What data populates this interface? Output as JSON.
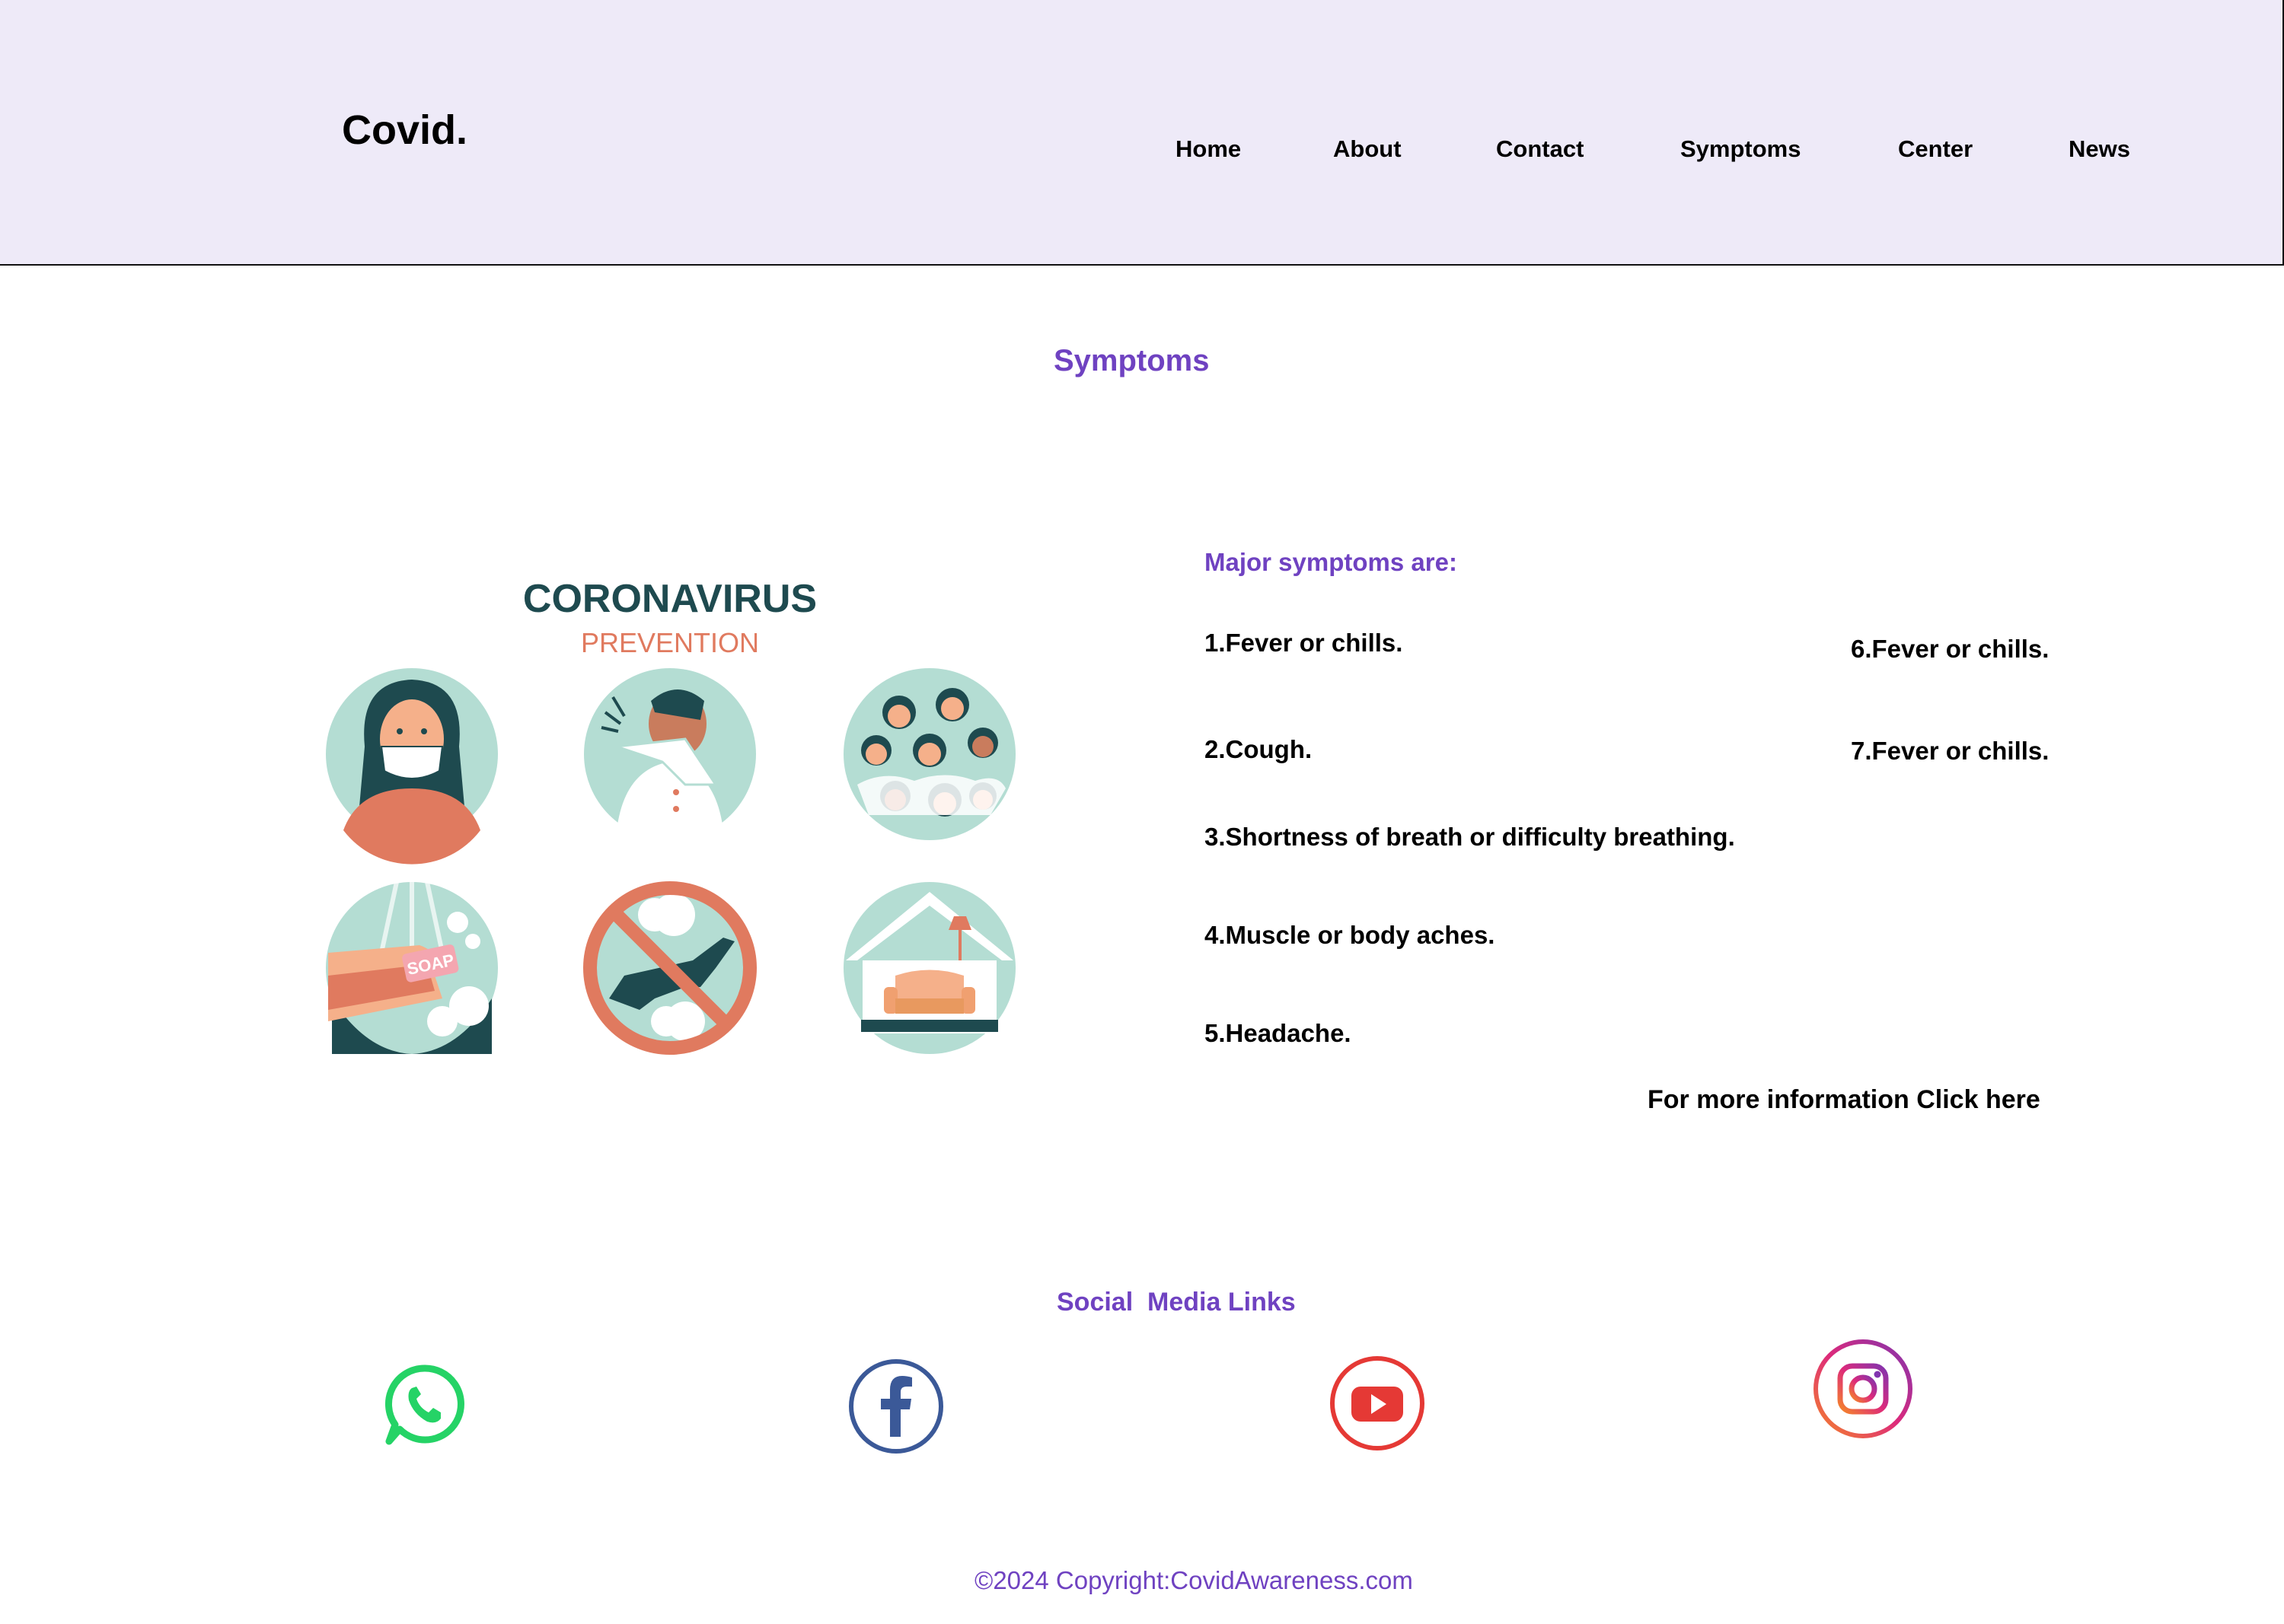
{
  "header": {
    "logo": "Covid.",
    "nav": [
      "Home",
      "About",
      "Contact",
      "Symptoms",
      "Center",
      "News"
    ]
  },
  "main": {
    "title": "Symptoms",
    "illustration": {
      "heading": "CORONAVIRUS",
      "subheading": "PREVENTION",
      "soap_label": "SOAP",
      "icons": [
        "face-mask-icon",
        "cough-into-elbow-icon",
        "avoid-crowds-icon",
        "wash-hands-icon",
        "no-travel-icon",
        "stay-home-icon"
      ]
    },
    "symptoms_heading": "Major symptoms are:",
    "symptoms": [
      "1.Fever or chills.",
      "2.Cough.",
      "3.Shortness of breath or difficulty breathing.",
      "4.Muscle or body aches.",
      "5.Headache.",
      "6.Fever or chills.",
      "7.Fever or chills."
    ],
    "more_info": "For more information Click here"
  },
  "social": {
    "heading": "Social  Media Links",
    "icons": [
      "whatsapp-icon",
      "facebook-icon",
      "youtube-icon",
      "instagram-icon"
    ]
  },
  "footer": {
    "copyright": "©2024 Copyright:CovidAwareness.com"
  },
  "colors": {
    "accent": "#6f42c1",
    "header_bg": "#eeeaf8",
    "whatsapp": "#25d366",
    "facebook": "#3b5998",
    "youtube": "#e53935",
    "instagram": "#c13584",
    "teal": "#1e4a4f",
    "mint": "#b4ddd3",
    "coral": "#e07a5f"
  }
}
